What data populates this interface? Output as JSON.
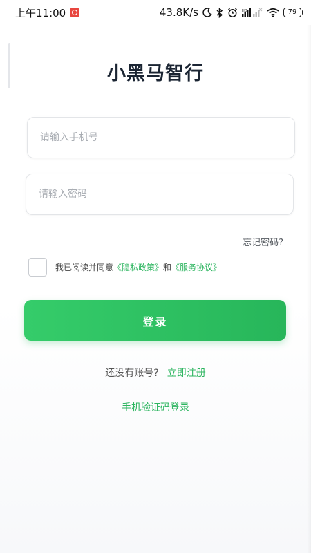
{
  "status_bar": {
    "time": "上午11:00",
    "network_speed": "43.8K/s",
    "battery_level": "79",
    "icons": [
      "app-notification-icon",
      "moon-icon",
      "bluetooth-icon",
      "alarm-icon",
      "signal-icon",
      "wifi-icon",
      "battery-icon"
    ]
  },
  "app": {
    "title": "小黑马智行"
  },
  "login_form": {
    "phone_placeholder": "请输入手机号",
    "phone_value": "",
    "password_placeholder": "请输入密码",
    "password_value": "",
    "forgot_password": "忘记密码?",
    "agreement_prefix": "我已阅读并同意",
    "privacy_policy": "《隐私政策》",
    "agreement_and": "和",
    "service_agreement": "《服务协议》",
    "agreement_checked": false,
    "login_button": "登录"
  },
  "footer": {
    "no_account": "还没有账号?",
    "register_now": "立即注册",
    "sms_login": "手机验证码登录"
  },
  "colors": {
    "accent": "#2cb55f",
    "button_start": "#35cc6a",
    "button_end": "#27b65a",
    "title": "#1b2533"
  }
}
